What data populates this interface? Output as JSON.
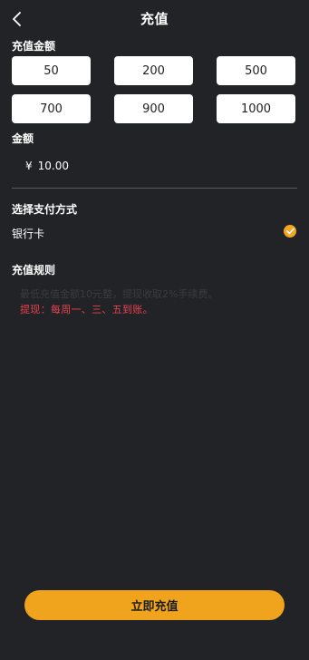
{
  "header": {
    "title": "充值",
    "back_icon": "chevron-left-icon"
  },
  "recharge_amount": {
    "label": "充值金额",
    "options": [
      "50",
      "200",
      "500",
      "700",
      "900",
      "1000"
    ]
  },
  "amount": {
    "label": "金额",
    "currency": "¥",
    "value": "10.00"
  },
  "payment": {
    "label": "选择支付方式",
    "method": "银行卡",
    "selected_icon": "check-circle-icon",
    "accent_color": "#F2A623"
  },
  "rules": {
    "label": "充值规则",
    "line1": "最低充值金额10元整，提现收取2%手续费。",
    "line2": "提现：每周一、三、五到账。",
    "line2_color": "#E8424E"
  },
  "submit": {
    "label": "立即充值",
    "color": "#F0A41D"
  }
}
